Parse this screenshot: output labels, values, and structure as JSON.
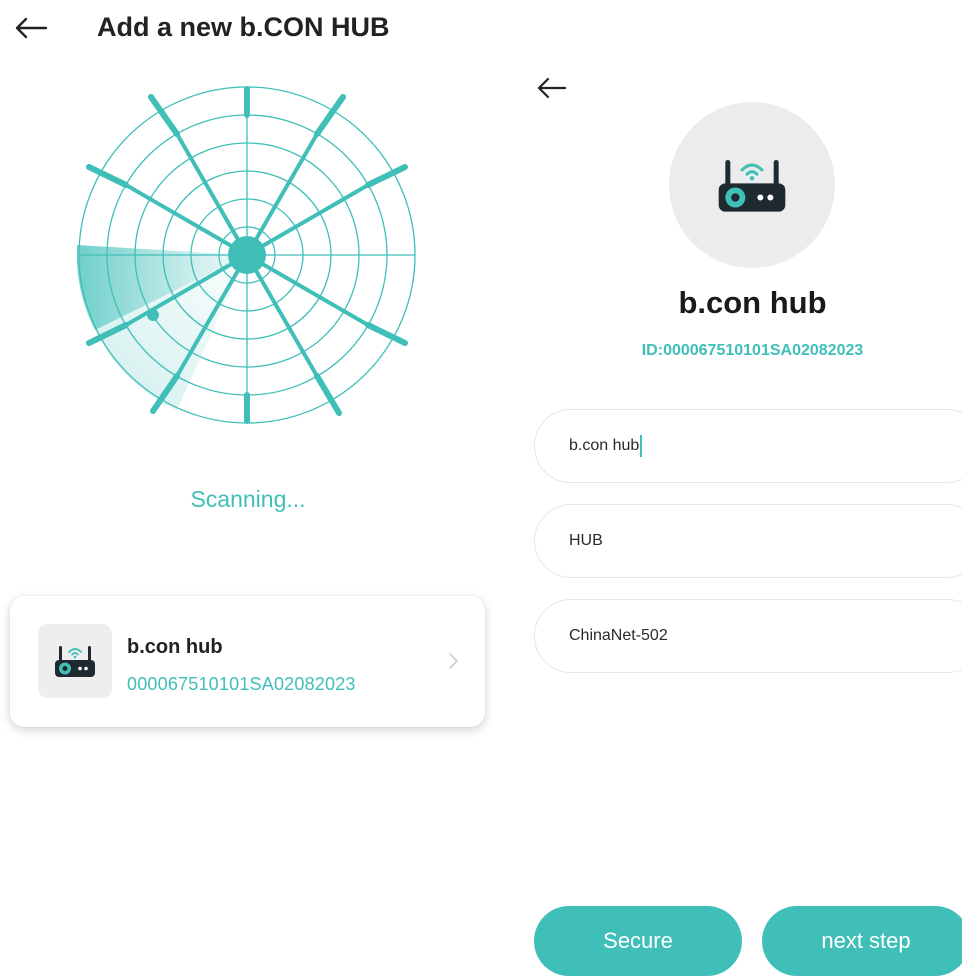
{
  "left": {
    "title": "Add a new b.CON HUB",
    "status": "Scanning...",
    "device": {
      "name": "b.con hub",
      "id": "000067510101SA02082023"
    }
  },
  "right": {
    "device_name": "b.con hub",
    "device_id": "ID:000067510101SA02082023",
    "fields": {
      "name_value": "b.con hub",
      "type_value": "HUB",
      "network_value": "ChinaNet-502"
    },
    "buttons": {
      "secure": "Secure",
      "next": "next step"
    }
  },
  "colors": {
    "accent": "#3fbfb8",
    "icon_dark": "#1f2a30",
    "card_bg": "#eeeeee"
  },
  "icons": {
    "back": "arrow-left-icon",
    "device": "router-wifi-icon",
    "chevron": "chevron-right-icon"
  }
}
